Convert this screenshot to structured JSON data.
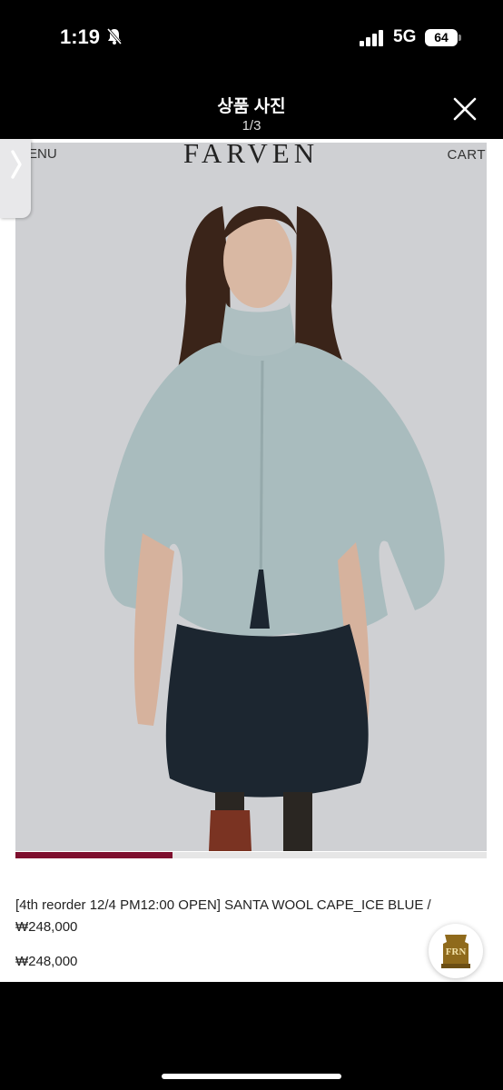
{
  "status_bar": {
    "time": "1:19",
    "network": "5G",
    "battery": "64"
  },
  "viewer": {
    "title": "상품 사진",
    "counter": "1/3"
  },
  "photo": {
    "brand": "FARVEN",
    "menu": "ENU",
    "cart": "CART"
  },
  "gallery": {
    "progress": 0.333
  },
  "product": {
    "title": "[4th reorder 12/4 PM12:00 OPEN] SANTA WOOL CAPE_ICE BLUE / ₩248,000",
    "price": "₩248,000"
  },
  "badge": {
    "text": "FRN"
  },
  "colors": {
    "accent": "#7e0f2e",
    "cape": "#a9bcbe",
    "skirt": "#1c2630"
  }
}
